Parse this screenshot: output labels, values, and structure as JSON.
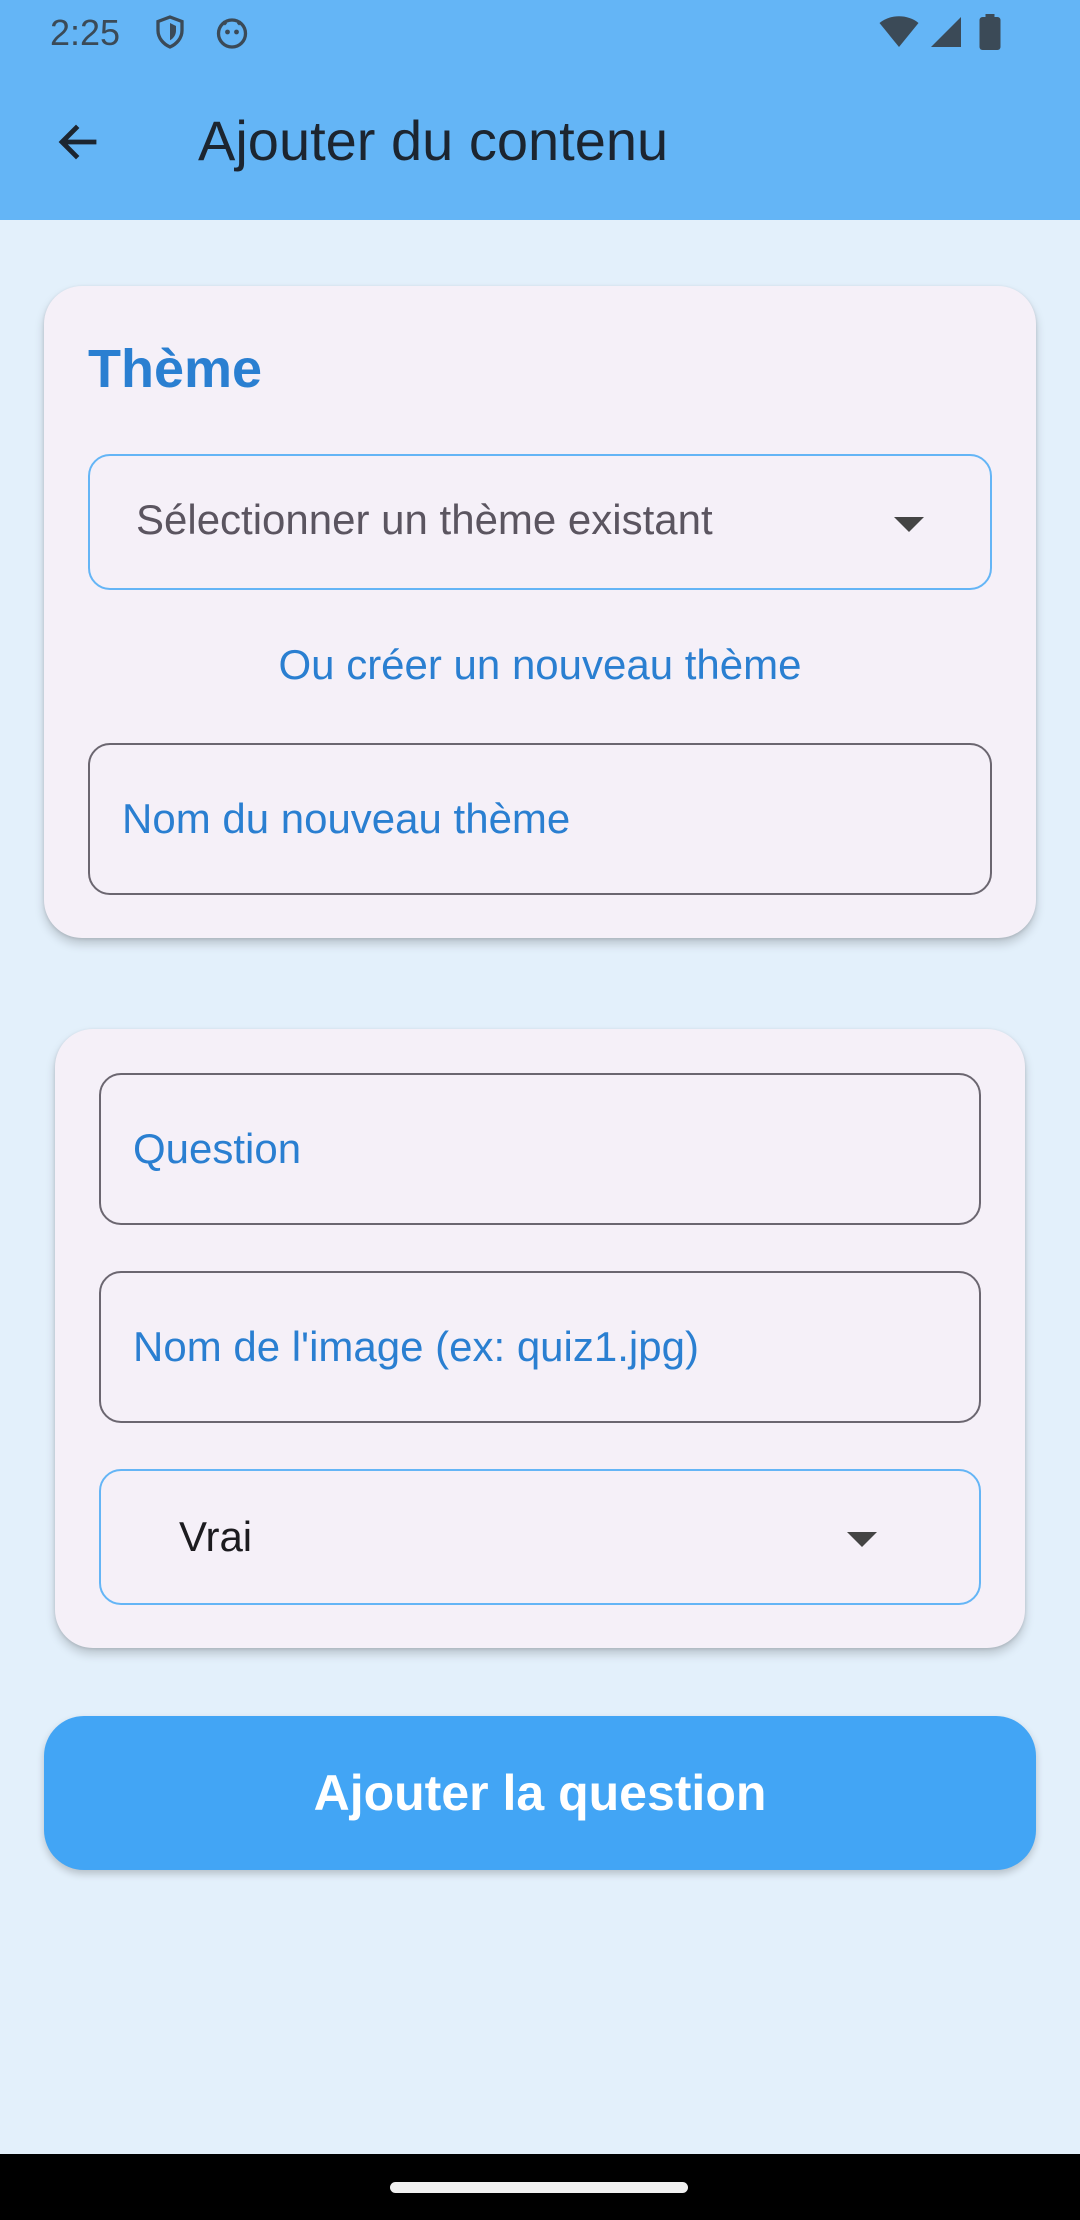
{
  "status_bar": {
    "time": "2:25",
    "icons": [
      "shield-icon",
      "android-face-icon",
      "wifi-icon",
      "signal-icon",
      "battery-icon"
    ]
  },
  "app_bar": {
    "title": "Ajouter du contenu",
    "back_icon": "arrow-back-icon"
  },
  "theme_card": {
    "title": "Thème",
    "theme_select": {
      "placeholder": "Sélectionner un thème existant",
      "value": ""
    },
    "create_link": "Ou créer un nouveau thème",
    "new_theme_input": {
      "label": "Nom du nouveau thème",
      "value": ""
    }
  },
  "question_card": {
    "question_input": {
      "label": "Question",
      "value": ""
    },
    "image_input": {
      "label": "Nom de l'image (ex: quiz1.jpg)",
      "value": ""
    },
    "answer_select": {
      "value": "Vrai"
    }
  },
  "submit_button": {
    "label": "Ajouter la question"
  },
  "colors": {
    "primary": "#64b5f6",
    "accent_text": "#2a7fd1",
    "button": "#42a5f5",
    "background": "#e3f0fb",
    "card": "#f5f0f8"
  }
}
